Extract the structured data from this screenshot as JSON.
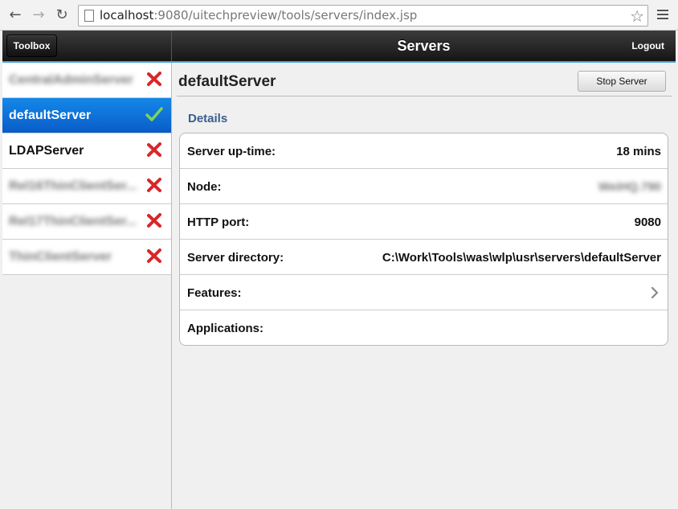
{
  "browser": {
    "url_host": "localhost",
    "url_rest": ":9080/uitechpreview/tools/servers/index.jsp"
  },
  "header": {
    "toolbox_label": "Toolbox",
    "title": "Servers",
    "logout_label": "Logout"
  },
  "sidebar": {
    "items": [
      {
        "label": "CentralAdminServer",
        "status": "stopped",
        "blurred": true
      },
      {
        "label": "defaultServer",
        "status": "running",
        "selected": true
      },
      {
        "label": "LDAPServer",
        "status": "stopped"
      },
      {
        "label": "Rel16ThinClientSer...",
        "status": "stopped",
        "blurred": true
      },
      {
        "label": "Rel17ThinClientSer...",
        "status": "stopped",
        "blurred": true
      },
      {
        "label": "ThinClientServer",
        "status": "stopped",
        "blurred": true
      }
    ]
  },
  "main": {
    "title": "defaultServer",
    "stop_label": "Stop Server",
    "section": "Details",
    "rows": [
      {
        "key": "Server up-time:",
        "value": "18 mins"
      },
      {
        "key": "Node:",
        "value": "WeiHQ.790",
        "blurred": true
      },
      {
        "key": "HTTP port:",
        "value": "9080"
      },
      {
        "key": "Server directory:",
        "value": "C:\\Work\\Tools\\was\\wlp\\usr\\servers\\defaultServer"
      },
      {
        "key": "Features:",
        "value": ""
      },
      {
        "key": "Applications:",
        "value": ""
      }
    ]
  },
  "colors": {
    "accent": "#4aa6dc",
    "selected": "#0a6fd8",
    "stopped": "#d9262a",
    "running": "#6cc24a",
    "section": "#3a5e8c"
  }
}
